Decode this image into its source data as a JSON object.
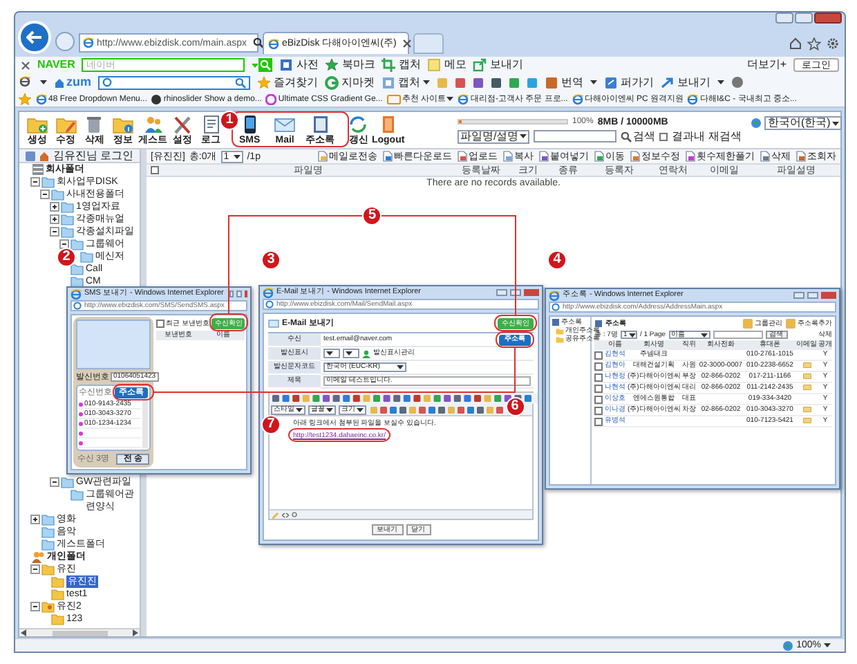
{
  "browser": {
    "address": "http://www.ebizdisk.com/main.aspx",
    "tab": "eBizDisk 다해아이엔씨(주)"
  },
  "naver_bar": {
    "logo": "NAVER",
    "search_placeholder": "네이버",
    "buttons": [
      "사전",
      "북마크",
      "캡처",
      "메모",
      "보내기"
    ],
    "more": "더보기+",
    "login": "로그인"
  },
  "zum_bar": {
    "logo": "zum",
    "buttons": [
      "즐겨찾기",
      "지마켓",
      "캡처",
      "번역",
      "퍼가기",
      "보내기"
    ]
  },
  "favorites": [
    "48 Free Dropdown Menu...",
    "rhinoslider Show a demo...",
    "Ultimate CSS Gradient Ge...",
    "추천 사이트",
    "대리점-고객사 주문 프로...",
    "다해아이엔씨 PC 원격지원",
    "다해I&C - 국내최고 중소..."
  ],
  "toolbar": {
    "buttons": [
      {
        "label": "생성",
        "kind": "create"
      },
      {
        "label": "수정",
        "kind": "edit"
      },
      {
        "label": "삭제",
        "kind": "delete"
      },
      {
        "label": "정보",
        "kind": "info"
      },
      {
        "label": "게스트",
        "kind": "guest"
      },
      {
        "label": "설정",
        "kind": "settings"
      },
      {
        "label": "로그",
        "kind": "log"
      },
      {
        "label": "SMS",
        "kind": "sms"
      },
      {
        "label": "Mail",
        "kind": "mail"
      },
      {
        "label": "주소록",
        "kind": "address"
      },
      {
        "label": "갱신",
        "kind": "refresh"
      },
      {
        "label": "Logout",
        "kind": "logout"
      }
    ]
  },
  "storage": {
    "percent": "100%",
    "level": 0.02,
    "usage": "8MB / 10000MB"
  },
  "search": {
    "scope": "파일명/설명",
    "button": "검색",
    "refine_label": "결과내 재검색",
    "refine_checked": false
  },
  "language": "한국어(한국)",
  "side_panel": {
    "login": "김유진님 로그인",
    "tree": [
      {
        "label": "회사폴더",
        "kind": "company_root",
        "children": [
          {
            "label": "회사업무DISK",
            "kind": "folder",
            "expanded": true,
            "children": [
              {
                "label": "사내전용폴더",
                "kind": "folder",
                "expanded": true,
                "children": [
                  {
                    "label": "1영업자료",
                    "kind": "folder",
                    "expanded": false
                  },
                  {
                    "label": "각종매뉴얼",
                    "kind": "folder",
                    "expanded": false
                  },
                  {
                    "label": "각종설치파일",
                    "kind": "folder",
                    "expanded": true,
                    "children": [
                      {
                        "label": "그룹웨어",
                        "kind": "folder",
                        "expanded": true,
                        "children": [
                          {
                            "label": "메신저",
                            "kind": "folder"
                          }
                        ]
                      },
                      {
                        "label": "Call",
                        "kind": "folder"
                      },
                      {
                        "label": "CM",
                        "kind": "folder"
                      }
                    ]
                  },
                  {
                    "label": "GW관련파일",
                    "kind": "folder",
                    "expanded": true,
                    "children": [
                      {
                        "label": "그룹웨어관련양식",
                        "kind": "folder"
                      }
                    ]
                  }
                ]
              }
            ]
          },
          {
            "label": "영화",
            "kind": "folder",
            "expanded": false
          },
          {
            "label": "음악",
            "kind": "folder"
          },
          {
            "label": "게스트폴더",
            "kind": "folder"
          }
        ]
      },
      {
        "label": "개인폴더",
        "kind": "personal_root",
        "children": [
          {
            "label": "유진",
            "kind": "personal_folder",
            "expanded": true,
            "children": [
              {
                "label": "유진진",
                "kind": "personal_folder",
                "selected": true
              },
              {
                "label": "test1",
                "kind": "personal_folder",
                "selected": false
              }
            ]
          },
          {
            "label": "유진2",
            "kind": "shared_folder",
            "expanded": true,
            "children": [
              {
                "label": "123",
                "kind": "personal_folder",
                "selected": false
              }
            ]
          }
        ]
      }
    ]
  },
  "file_list": {
    "folder": "[유진진]",
    "total": "총:0개",
    "page": "1",
    "pages": "/1p",
    "actions": [
      "메일로전송",
      "빠른다운로드",
      "업로드",
      "복사",
      "붙여넣기",
      "이동",
      "정보수정",
      "횟수제한풀기",
      "삭제",
      "조회자"
    ],
    "select_all_checked": false,
    "columns": [
      "파일명",
      "등록날짜",
      "크기",
      "종류",
      "등록자",
      "연락처",
      "이메일",
      "파일설명"
    ],
    "empty_message": "There are no records available."
  },
  "status_bar": {
    "zoom": "100%"
  },
  "sms_window": {
    "title": "SMS 보내기 - Windows Internet Explorer",
    "address": "http://www.ebizdisk.com/SMS/SendSMS.aspx",
    "sender_label": "발신번호",
    "sender": "01064051423",
    "recipient_label": "수신번호",
    "address_book": "주소록",
    "recipients": [
      "010-9143-2435",
      "010-3043-3270",
      "010-1234-1234"
    ],
    "count": "수신 3명",
    "send": "전 송",
    "recent_checked": false,
    "recent_label": "최근 보낸번호",
    "confirm": "수신확인",
    "columns": [
      "보낸번호",
      "이름"
    ]
  },
  "mail_window": {
    "title": "E-Mail 보내기 - Windows Internet Explorer",
    "address": "http://www.ebizdisk.com/Mail/SendMail.aspx",
    "heading": "E-Mail 보내기",
    "confirm": "수신확인",
    "fields": [
      {
        "label": "수신",
        "kind": "recipient",
        "value": "test.email@naver.com"
      },
      {
        "label": "발신표시",
        "kind": "sender",
        "link": "발신표시관리"
      },
      {
        "label": "발신문자코드",
        "kind": "select",
        "value": "한국어 (EUC-KR)"
      },
      {
        "label": "제목",
        "kind": "text",
        "value": "이메일 테스트입니다."
      }
    ],
    "address_book": "주소록",
    "editor_selects": [
      "스타일",
      "글꼴",
      "크기"
    ],
    "body": "아래 링크에서 첨부된 파일을 보실수 있습니다.",
    "link": "http://test1234.dahaeinc.co.kr/",
    "buttons": [
      "보내기",
      "닫기"
    ]
  },
  "address_window": {
    "title": "주소록 - Windows Internet Explorer",
    "address": "http://www.ebizdisk.com/Address/AddressMain.aspx",
    "tree": [
      "주소록",
      "개인주소록",
      "공유주소록"
    ],
    "heading": "주소록",
    "links": [
      "그룹관리",
      "주소록추가"
    ],
    "total": "총 : 7명",
    "page": "1",
    "pages": "/ 1 Page",
    "search_scope": "이름",
    "search": "검색",
    "delete": "삭제",
    "columns": [
      "이름",
      "회사명",
      "직위",
      "회사전화",
      "휴대폰",
      "이메일",
      "공개"
    ],
    "rows": [
      {
        "checked": false,
        "name": "김현석",
        "company": "주넴태크",
        "mobile": "010-2761-1015",
        "email": false,
        "public": "Y"
      },
      {
        "checked": false,
        "name": "김현아",
        "company": "대해건설기획",
        "position": "사원",
        "phone": "02-3000-0007",
        "mobile": "010-2238-6652",
        "email": true,
        "public": "Y"
      },
      {
        "checked": false,
        "name": "나현정",
        "company": "(주)다해아이엔씨",
        "position": "부장",
        "phone": "02-866-0202",
        "mobile": "017-211-1166",
        "email": true,
        "public": "Y"
      },
      {
        "checked": false,
        "name": "나현석",
        "company": "(주)다해아이엔씨",
        "position": "대리",
        "phone": "02-866-0202",
        "mobile": "011-2142-2435",
        "email": true,
        "public": "Y"
      },
      {
        "checked": false,
        "name": "이상호",
        "company": "엔에스원통합",
        "position": "대표",
        "mobile": "019-334-3420",
        "email": false,
        "public": "Y"
      },
      {
        "checked": false,
        "name": "이나경",
        "company": "(주)다해아이엔씨",
        "position": "차장",
        "phone": "02-866-0202",
        "mobile": "010-3043-3270",
        "email": true,
        "public": "Y"
      },
      {
        "checked": false,
        "name": "유병석",
        "mobile": "010-7123-5421",
        "email": true,
        "public": "Y"
      }
    ]
  },
  "annotations": [
    "1",
    "2",
    "3",
    "4",
    "5",
    "6",
    "7"
  ]
}
